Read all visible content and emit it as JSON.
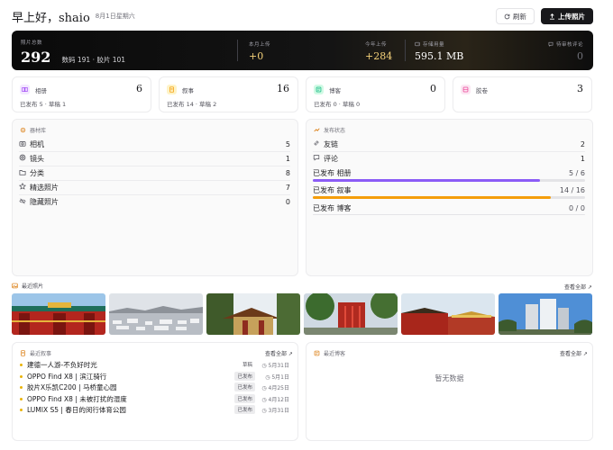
{
  "header": {
    "greeting": "早上好，shaio",
    "date": "8月1日星期六",
    "refresh_label": "刷新",
    "upload_label": "上传照片",
    "refresh_icon": "refresh-icon",
    "upload_icon": "upload-icon"
  },
  "hero": {
    "total_label": "照片总数",
    "total_value": "292",
    "total_sub": "数码 191 · 胶片 101",
    "month_label": "本月上传",
    "month_value": "+0",
    "year_label": "今年上传",
    "year_value": "+284",
    "storage_label": "存储用量",
    "storage_value": "595.1 MB",
    "comments_label": "待审核评论",
    "comments_value": "0"
  },
  "stat_cards": [
    {
      "name": "相册",
      "value": "6",
      "meta": "已发布 5 · 草稿 1",
      "icon": "album-icon",
      "color": "#a855f7",
      "bg": "#f3e8ff"
    },
    {
      "name": "叙事",
      "value": "16",
      "meta": "已发布 14 · 草稿 2",
      "icon": "story-icon",
      "color": "#f59e0b",
      "bg": "#fef3c7"
    },
    {
      "name": "博客",
      "value": "0",
      "meta": "已发布 0 · 草稿 0",
      "icon": "blog-icon",
      "color": "#10b981",
      "bg": "#d1fae5"
    },
    {
      "name": "胶卷",
      "value": "3",
      "meta": "",
      "icon": "film-icon",
      "color": "#ec4899",
      "bg": "#fce7f3"
    }
  ],
  "library": {
    "title": "器材库",
    "items": [
      {
        "label": "相机",
        "value": "5",
        "icon": "camera-icon"
      },
      {
        "label": "镜头",
        "value": "1",
        "icon": "lens-icon"
      },
      {
        "label": "分类",
        "value": "8",
        "icon": "folder-icon"
      },
      {
        "label": "精选照片",
        "value": "7",
        "icon": "star-icon"
      },
      {
        "label": "隐藏照片",
        "value": "0",
        "icon": "eye-off-icon"
      }
    ]
  },
  "publish": {
    "title": "发布状态",
    "items": [
      {
        "label": "友链",
        "value": "2",
        "icon": "link-icon"
      },
      {
        "label": "评论",
        "value": "1",
        "icon": "comment-icon"
      }
    ],
    "progress": [
      {
        "label": "已发布 相册",
        "value": "5 / 6",
        "fraction": 0.833,
        "color": "#8b5cf6"
      },
      {
        "label": "已发布 叙事",
        "value": "14 / 16",
        "fraction": 0.875,
        "color": "#f59e0b"
      },
      {
        "label": "已发布 博客",
        "value": "0 / 0",
        "fraction": 0,
        "color": "#10b981"
      }
    ]
  },
  "recent_photos": {
    "title": "最近照片",
    "see_all": "查看全部 ↗"
  },
  "recent_stories": {
    "title": "最近叙事",
    "see_all": "查看全部 ↗",
    "items": [
      {
        "title": "建德一人游-不负好时光",
        "status": "草稿",
        "date": "5月31日"
      },
      {
        "title": "OPPO Find X8 | 滨江骑行",
        "status": "已发布",
        "date": "5月1日"
      },
      {
        "title": "胶片X乐凯C200 | 马桥童心园",
        "status": "已发布",
        "date": "4月25日"
      },
      {
        "title": "OPPO Find X8 | 未被打扰的湿度",
        "status": "已发布",
        "date": "4月12日"
      },
      {
        "title": "LUMIX S5 | 春日的闵行体育公园",
        "status": "已发布",
        "date": "3月31日"
      }
    ]
  },
  "recent_blogs": {
    "title": "最近博客",
    "see_all": "查看全部 ↗",
    "empty_text": "暂无数据"
  }
}
